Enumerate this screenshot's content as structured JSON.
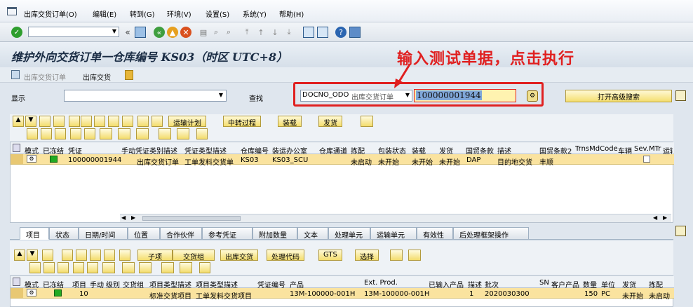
{
  "menu": {
    "items": [
      "出库交货订单(O)",
      "编辑(E)",
      "转到(G)",
      "环境(V)",
      "设置(S)",
      "系统(Y)",
      "帮助(H)"
    ]
  },
  "header": {
    "title": "维护外向交货订单一仓库编号 KS03（时区 UTC+8）"
  },
  "apptoolbar": {
    "item1": "出库交货订单",
    "item2": "出库交货"
  },
  "annotation": {
    "text": "输入测试单据，点击执行"
  },
  "search": {
    "show_label": "显示",
    "find_label": "查找",
    "type_code": "DOCNO_ODO",
    "type_desc": "出库交货订单",
    "value": "100000001944",
    "advanced_button": "打开高级搜索"
  },
  "upper_toolbar": {
    "btn_transport_plan": "运输计划",
    "btn_transfer_process": "中转过程",
    "btn_load": "装载",
    "btn_issue": "发货"
  },
  "upper_grid": {
    "columns": [
      "模式",
      "已冻结",
      "凭证",
      "手动",
      "凭证类别描述",
      "凭证类型描述",
      "仓库编号",
      "装运办公室",
      "仓库通道",
      "拣配",
      "包装状态",
      "装载",
      "发货",
      "国贸条款",
      "描述",
      "国贸条款2",
      "TrnsMdCode",
      "车辆",
      "Sev.",
      "MTr",
      "运输"
    ],
    "row": {
      "doc": "100000001944",
      "cat_desc": "出库交货订单",
      "type_desc": "工单发料交货单",
      "whse": "KS03",
      "ship_office": "KS03_SCU",
      "pick": "未启动",
      "pack": "未开始",
      "load": "未开始",
      "issue": "未开始",
      "incoterm": "DAP",
      "desc": "目的地交货",
      "incoterm2": "丰顺"
    }
  },
  "tabs": [
    "项目",
    "状态",
    "日期/时间",
    "位置",
    "合作伙伴",
    "参考凭证",
    "附加数量",
    "文本",
    "处理单元",
    "运输单元",
    "有效性",
    "后处理框架操作"
  ],
  "lower_toolbar": {
    "btn_sub": "子项",
    "btn_delivery_group": "交货组",
    "btn_out_delivery": "出库交货",
    "btn_process_code": "处理代码",
    "btn_gts": "GTS",
    "btn_select": "选择"
  },
  "lower_grid": {
    "columns": [
      "模式",
      "已冻结",
      "项目",
      "手动",
      "级别",
      "交货组",
      "项目类型描述",
      "项目类型描述",
      "凭证编号",
      "产品",
      "Ext. Prod.",
      "已输入产品",
      "描述",
      "批次",
      "SN",
      "客户产品",
      "数量",
      "单位",
      "发货",
      "拣配"
    ],
    "row": {
      "item": "10",
      "type_desc1": "标准交货项目",
      "type_desc2": "工单发料交货项目",
      "product": "13M-100000-001H",
      "ext_prod": "13M-100000-001H",
      "desc": "1",
      "batch": "2020030300",
      "qty": "150",
      "unit": "PC",
      "issue": "未开始",
      "pick": "未启动"
    }
  },
  "colors": {
    "accent": "#e02020",
    "row_highlight": "#fae39f",
    "frozen_green": "#22aa22"
  }
}
